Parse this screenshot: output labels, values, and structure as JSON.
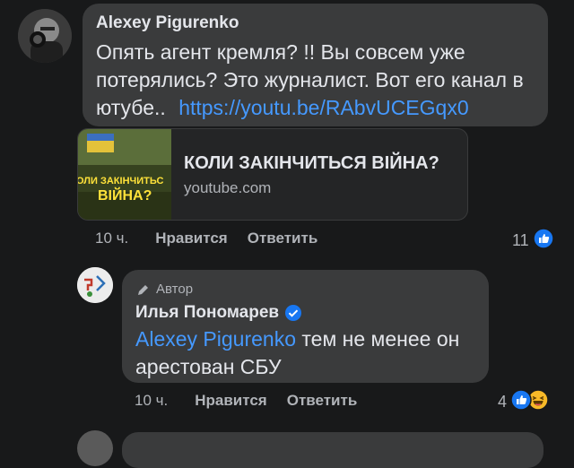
{
  "comment1": {
    "author": "Alexey Pigurenko",
    "text": "Опять агент кремля? !! Вы совсем уже потерялись? Это журналист. Вот его канал в ютубе..",
    "link": "https://youtu.be/RAbvUCEGqx0",
    "preview": {
      "title": "КОЛИ ЗАКІНЧИТЬСЯ ВІЙНА?",
      "domain": "youtube.com",
      "thumb_line1": "ОЛИ ЗАКІНЧИТЬС",
      "thumb_line2": "ВІЙНА?"
    },
    "time": "10 ч.",
    "like_label": "Нравится",
    "reply_label": "Ответить",
    "reaction_count": "11",
    "reaction_icons": [
      "like-icon"
    ]
  },
  "comment2": {
    "badge": "Автор",
    "author": "Илья Пономарев",
    "verified": true,
    "mention": "Alexey Pigurenko",
    "text_line1": "тем не менее он",
    "text_line2": "арестован СБУ",
    "time": "10 ч.",
    "like_label": "Нравится",
    "reply_label": "Ответить",
    "reaction_count": "4",
    "reaction_icons": [
      "like-icon",
      "laugh-icon"
    ]
  },
  "colors": {
    "background": "#18191a",
    "bubble": "#3a3b3c",
    "link": "#4599ff",
    "meta": "#b0b3b8",
    "like_blue": "#1877f2",
    "laugh_yellow": "#f7b928"
  }
}
